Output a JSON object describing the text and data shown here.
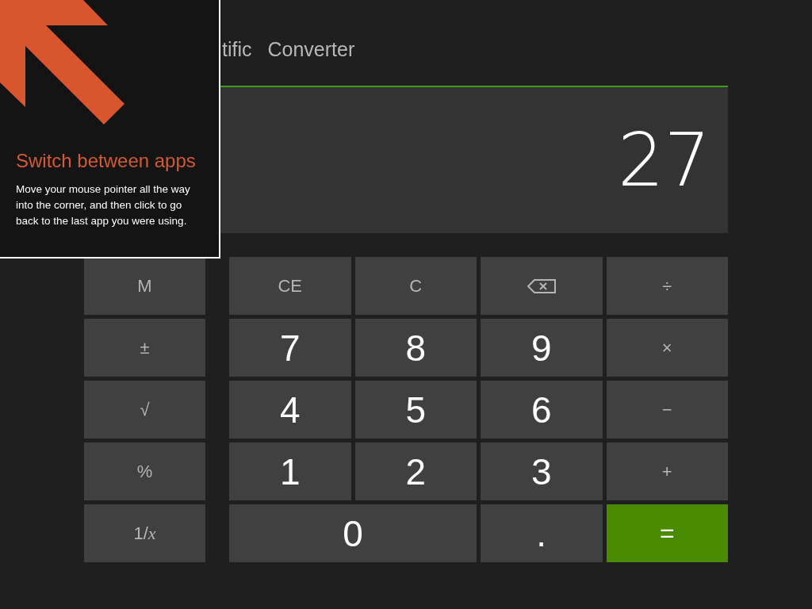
{
  "tabs": [
    {
      "label": "tific",
      "selected": false
    },
    {
      "label": "Converter",
      "selected": false
    }
  ],
  "display": {
    "value": "27"
  },
  "side_keys": [
    {
      "label": "M",
      "kind": "function"
    },
    {
      "label": "±",
      "kind": "function"
    },
    {
      "label": "√",
      "kind": "function"
    },
    {
      "label": "%",
      "kind": "function"
    },
    {
      "label": "1/*x*",
      "kind": "function"
    }
  ],
  "keys": [
    {
      "label": "CE",
      "kind": "function"
    },
    {
      "label": "C",
      "kind": "function"
    },
    {
      "kind": "backspace"
    },
    {
      "label": "÷",
      "kind": "function"
    },
    {
      "label": "7",
      "kind": "digit"
    },
    {
      "label": "8",
      "kind": "digit"
    },
    {
      "label": "9",
      "kind": "digit"
    },
    {
      "label": "×",
      "kind": "function"
    },
    {
      "label": "4",
      "kind": "digit"
    },
    {
      "label": "5",
      "kind": "digit"
    },
    {
      "label": "6",
      "kind": "digit"
    },
    {
      "label": "−",
      "kind": "function"
    },
    {
      "label": "1",
      "kind": "digit"
    },
    {
      "label": "2",
      "kind": "digit"
    },
    {
      "label": "3",
      "kind": "digit"
    },
    {
      "label": "+",
      "kind": "function"
    },
    {
      "label": "0",
      "kind": "wide-digit"
    },
    {
      "label": ".",
      "kind": "digit"
    },
    {
      "label": "=",
      "kind": "equals"
    }
  ],
  "tip": {
    "title": "Switch between apps",
    "text": "Move your mouse pointer all the way into the corner, and then click to go back to the last app you were using."
  }
}
